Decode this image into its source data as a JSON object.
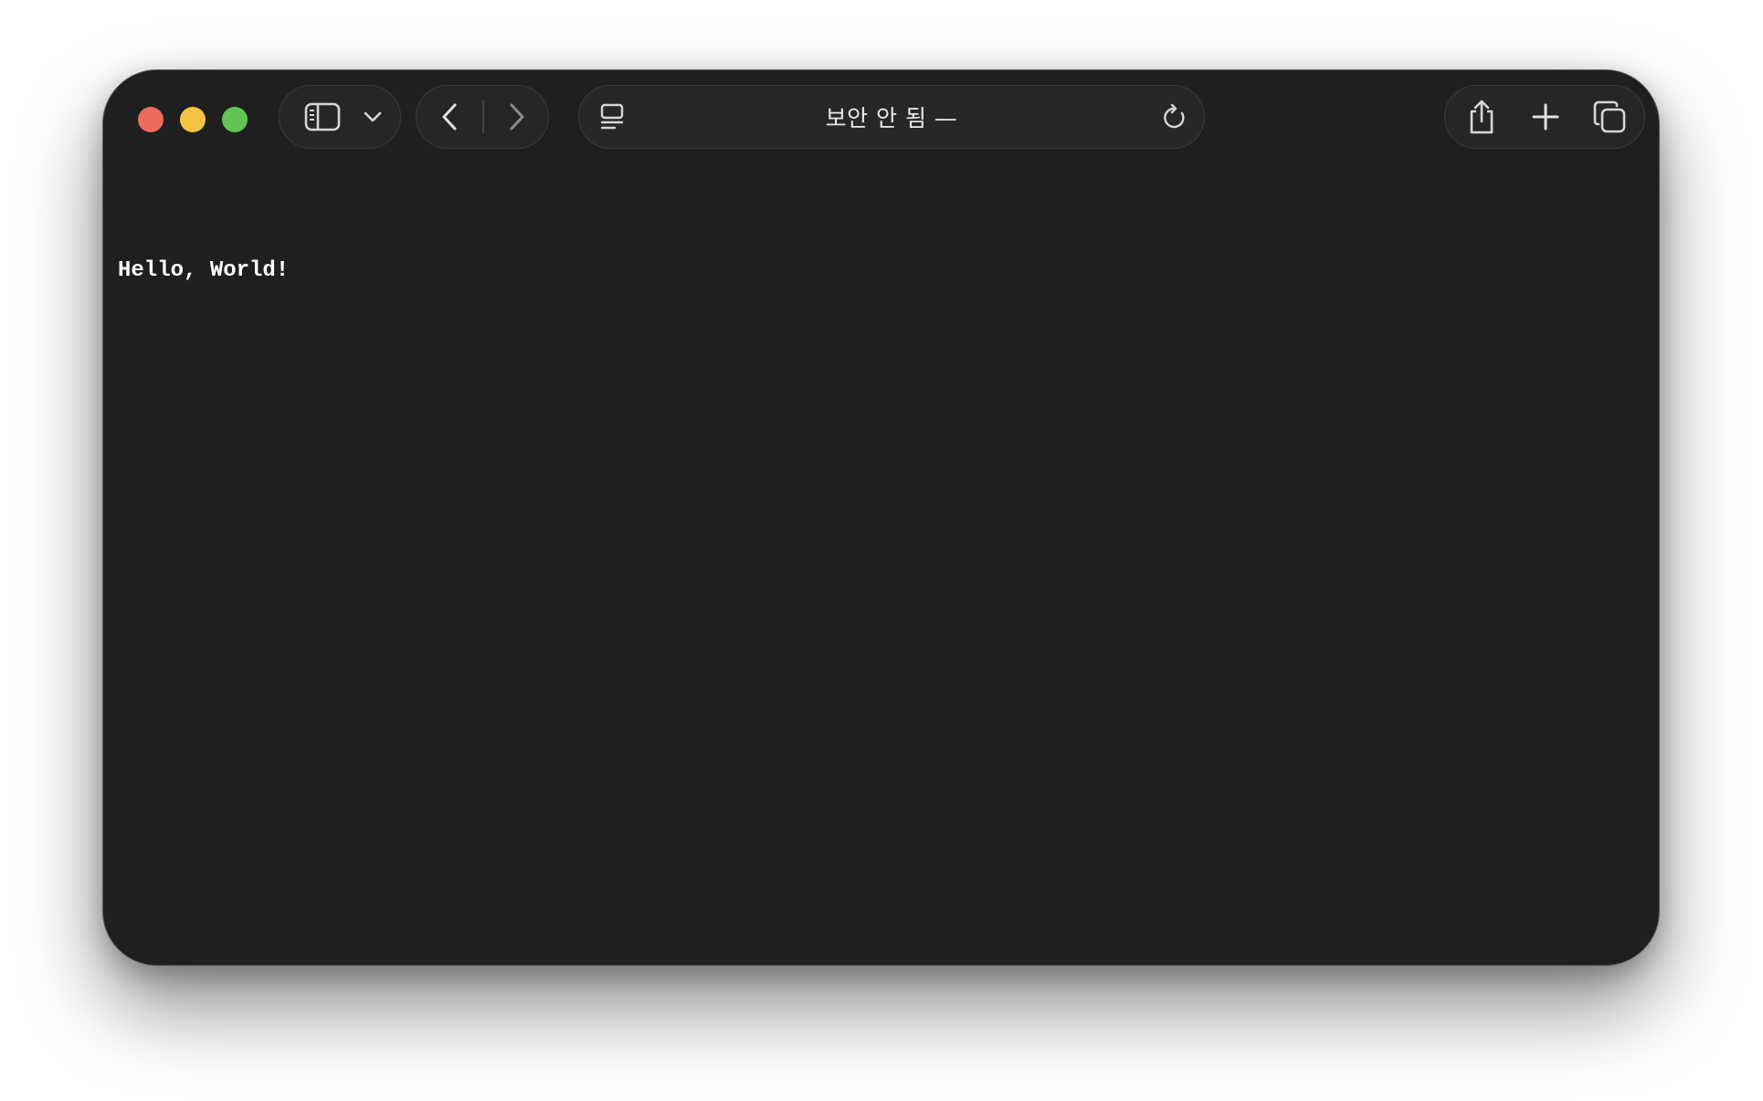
{
  "browser": {
    "address_title": "보안 안 됨 —",
    "icons": {
      "sidebar": "sidebar-icon",
      "sidebar_menu": "chevron-down-icon",
      "back": "chevron-left-icon",
      "forward": "chevron-right-icon",
      "page_menu": "page-menu-icon",
      "reload": "reload-icon",
      "share": "share-icon",
      "new_tab": "plus-icon",
      "tab_overview": "tabs-overview-icon"
    },
    "colors": {
      "close": "#ed6a5e",
      "minimize": "#f5c342",
      "zoom": "#61c554",
      "window_background": "#1f1f1f"
    }
  },
  "page": {
    "body_text": "Hello, World!"
  }
}
